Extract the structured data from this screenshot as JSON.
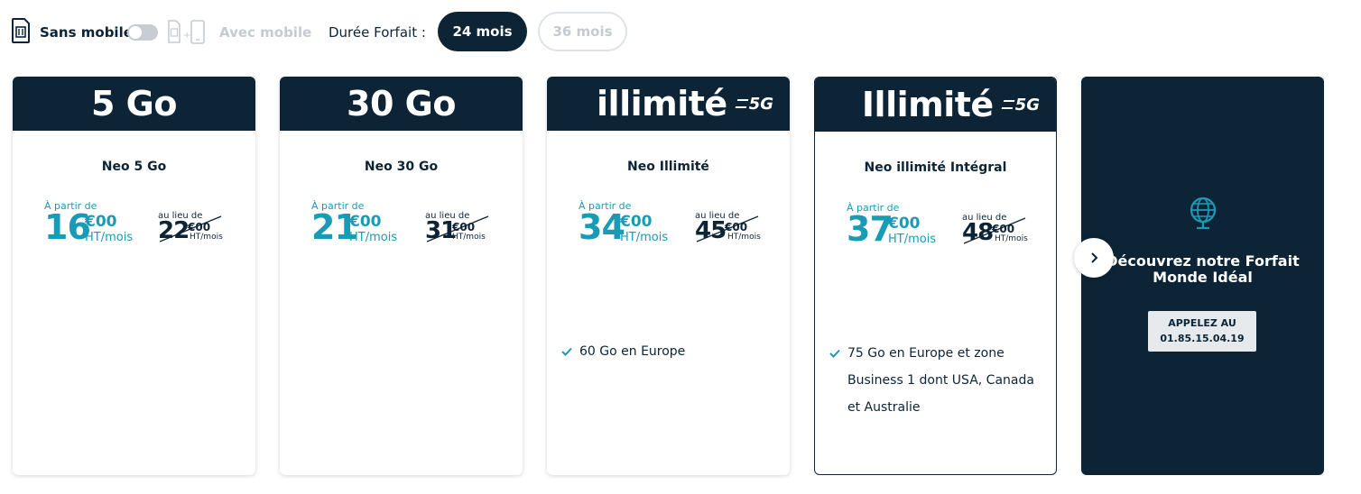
{
  "filters": {
    "sans_mobile": "Sans mobile",
    "avec_mobile": "Avec mobile",
    "duree_label": "Durée Forfait :",
    "durations": [
      "24 mois",
      "36 mois"
    ],
    "selected_duration": "24 mois"
  },
  "common": {
    "a_partir": "À partir de",
    "au_lieu": "au lieu de",
    "cents": "€00",
    "ht_mois": "HT/mois",
    "five_g": "5G"
  },
  "cards": [
    {
      "header": "5 Go",
      "name": "Neo 5 Go",
      "price": "16",
      "old_price": "22",
      "features": []
    },
    {
      "header": "30 Go",
      "name": "Neo 30 Go",
      "price": "21",
      "old_price": "31",
      "features": []
    },
    {
      "header": "illimité",
      "name": "Neo Illimité",
      "price": "34",
      "old_price": "45",
      "features": [
        "60 Go en Europe"
      ]
    },
    {
      "header": "Illimité",
      "name": "Neo illimité Intégral",
      "price": "37",
      "old_price": "48",
      "features": [
        "75 Go en Europe et zone",
        "Business 1 dont USA, Canada",
        "et Australie"
      ]
    }
  ],
  "promo": {
    "title_line1": "Découvrez notre Forfait",
    "title_line2": "Monde Idéal",
    "button_line1": "APPELEZ AU",
    "button_line2": "01.85.15.04.19"
  },
  "colors": {
    "navy": "#0d2436",
    "teal": "#1a9bb5"
  },
  "icons": [
    "sim-icon",
    "sim-phone-icon",
    "check-icon",
    "globe-icon",
    "chevron-right-icon"
  ]
}
